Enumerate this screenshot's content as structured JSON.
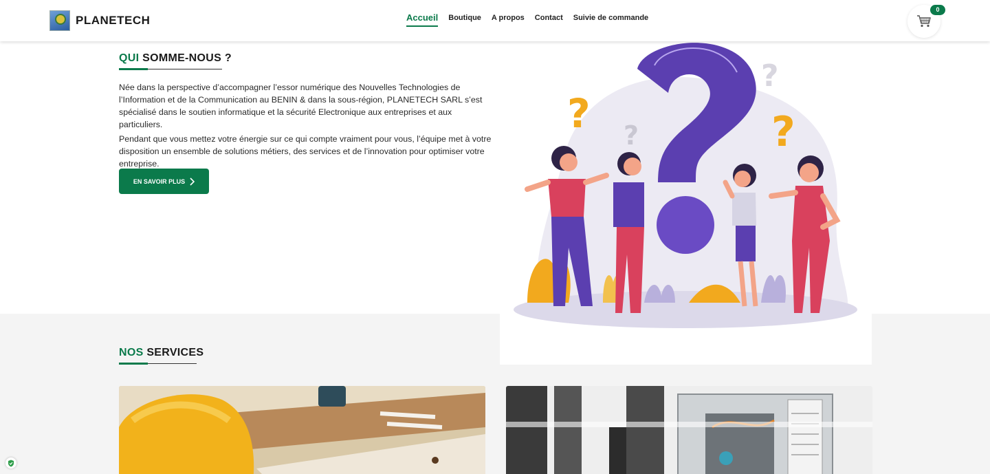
{
  "header": {
    "brand": "PLANETECH",
    "nav": [
      {
        "label": "Accueil",
        "active": true
      },
      {
        "label": "Boutique",
        "active": false
      },
      {
        "label": "A propos",
        "active": false
      },
      {
        "label": "Contact",
        "active": false
      },
      {
        "label": "Suivie de commande",
        "active": false
      }
    ],
    "cart_count": "0",
    "cart_icon": "cart-icon"
  },
  "about": {
    "title_accent": "QUI",
    "title_rest": " SOMME-NOUS ?",
    "paragraph1": "Née dans la perspective d’accompagner l’essor numérique des Nouvelles Technologies de l’Information et de la Communication au BENIN & dans la sous-région, PLANETECH SARL s’est spécialisé dans le soutien informatique et la sécurité Electronique aux entreprises et aux particuliers.",
    "paragraph2": "Pendant que vous mettez votre énergie sur ce qui compte vraiment pour vous, l’équipe met à votre disposition un ensemble de solutions métiers, des services et de l’innovation pour optimiser votre entreprise.",
    "cta_label": "EN SAVOIR PLUS"
  },
  "services": {
    "title_accent": "NOS",
    "title_rest": " SERVICES"
  },
  "colors": {
    "accent": "#0b7a4b",
    "band": "#f4f4f4"
  }
}
